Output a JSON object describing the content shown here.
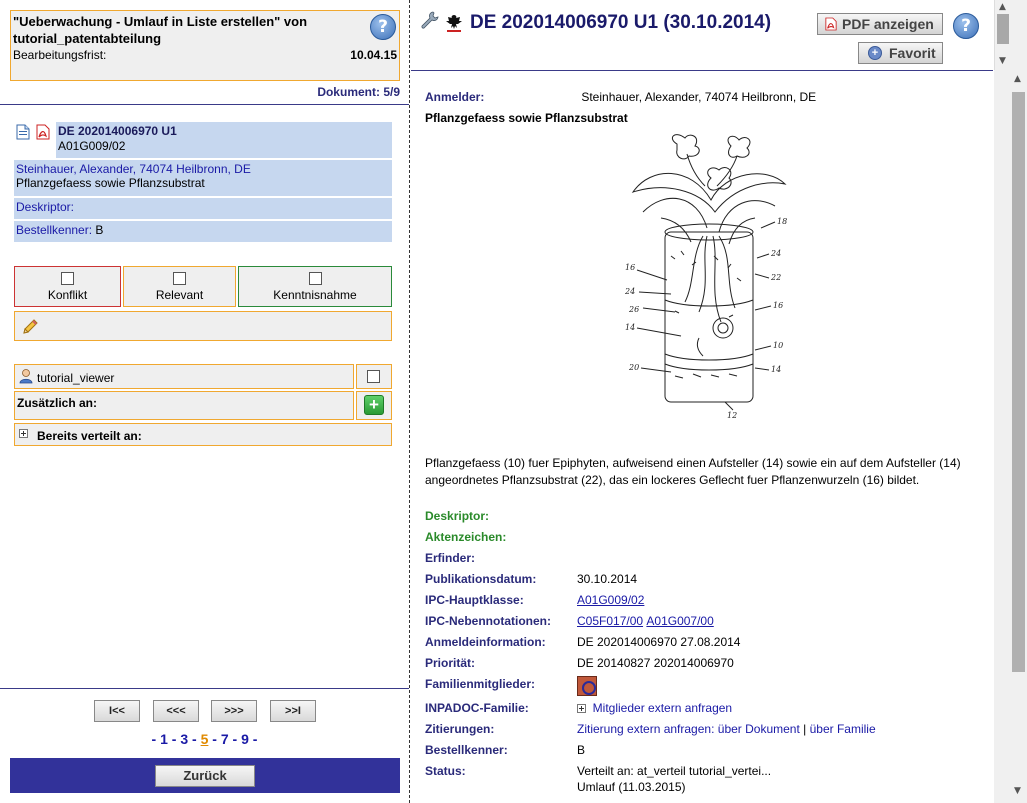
{
  "left": {
    "task": {
      "title": "\"Ueberwachung - Umlauf in Liste erstellen\" von tutorial_patentabteilung",
      "deadline_label": "Bearbeitungsfrist:",
      "deadline_value": "10.04.15"
    },
    "document_counter": "Dokument: 5/9",
    "doc": {
      "number": "DE 202014006970 U1",
      "ipc": "A01G009/02",
      "applicant": "Steinhauer, Alexander, 74074 Heilbronn, DE",
      "title": "Pflanzgefaess sowie Pflanzsubstrat",
      "deskriptor_label": "Deskriptor:",
      "bestellkenner_label": "Bestellkenner:",
      "bestellkenner_value": "B"
    },
    "flags": {
      "konflikt": "Konflikt",
      "relevant": "Relevant",
      "kenntnisnahme": "Kenntnisnahme"
    },
    "recipient": "tutorial_viewer",
    "additional_label": "Zusätzlich an:",
    "already_distributed_label": "Bereits verteilt an:",
    "nav": {
      "first": "I<<",
      "prev": "<<<",
      "next": ">>>",
      "last": ">>I"
    },
    "pages": [
      "1",
      "3",
      "5",
      "7",
      "9"
    ],
    "current_page": "5",
    "back_label": "Zurück"
  },
  "right": {
    "title": "DE 202014006970 U1 (30.10.2014)",
    "pdf_button": "PDF anzeigen",
    "favorite_button": "Favorit",
    "applicant_label": "Anmelder:",
    "applicant_value": "Steinhauer, Alexander, 74074 Heilbronn, DE",
    "abstract_title": "Pflanzgefaess sowie Pflanzsubstrat",
    "abstract": "Pflanzgefaess (10) fuer Epiphyten, aufweisend einen Aufsteller (14) sowie ein auf dem Aufsteller (14) angeordnetes Pflanzsubstrat (22), das ein lockeres Geflecht fuer Pflanzenwurzeln (16) bildet.",
    "drawing_labels": [
      "18",
      "16",
      "24",
      "22",
      "24",
      "26",
      "16",
      "14",
      "10",
      "20",
      "14",
      "12"
    ],
    "fields": {
      "deskriptor": "Deskriptor:",
      "aktenzeichen": "Aktenzeichen:",
      "erfinder": "Erfinder:",
      "pubdate_label": "Publikationsdatum:",
      "pubdate_value": "30.10.2014",
      "ipc_main_label": "IPC-Hauptklasse:",
      "ipc_main_value": "A01G009/02",
      "ipc_side_label": "IPC-Nebennotationen:",
      "ipc_side_1": "C05F017/00",
      "ipc_side_2": "A01G007/00",
      "appl_label": "Anmeldeinformation:",
      "appl_value": "DE 202014006970 27.08.2014",
      "prio_label": "Priorität:",
      "prio_value": "DE 20140827 202014006970",
      "family_label": "Familienmitglieder:",
      "inpadoc_label": "INPADOC-Familie:",
      "inpadoc_value": "Mitglieder extern anfragen",
      "citations_label": "Zitierungen:",
      "citations_prefix": "Zitierung extern anfragen:",
      "citations_doc": "über Dokument",
      "citations_sep": "|",
      "citations_family": "über Familie",
      "bestellkenner_label": "Bestellkenner:",
      "bestellkenner_value": "B",
      "status_label": "Status:",
      "status_line1": "Verteilt an: at_verteil tutorial_vertei...",
      "status_line2": "Umlauf (11.03.2015)"
    }
  },
  "colors": {
    "accent_orange": "#f0a830",
    "navy": "#32329a",
    "row_blue": "#c6d7ef",
    "label_green": "#2a8a2a",
    "conflict_red": "#cc3333",
    "ack_green": "#2a8a3a"
  },
  "icons": [
    "help-icon",
    "text-document-icon",
    "pdf-icon",
    "pencil-icon",
    "user-icon",
    "plus-icon",
    "expand-icon",
    "wrench-icon",
    "dpma-eagle-icon",
    "star-icon",
    "family-icon"
  ]
}
